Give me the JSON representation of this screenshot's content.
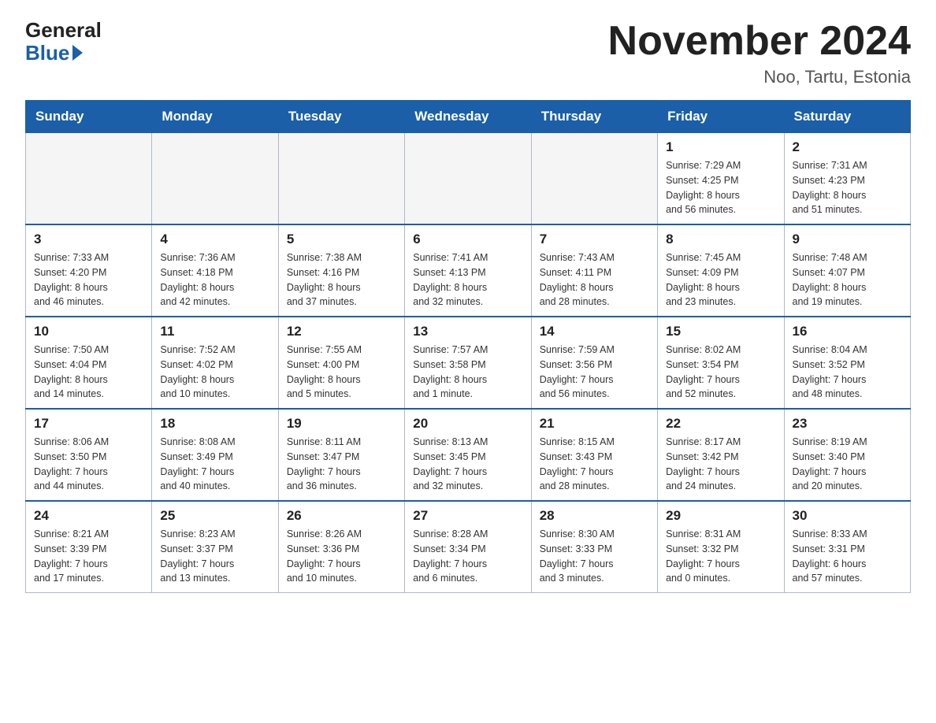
{
  "logo": {
    "general": "General",
    "blue": "Blue"
  },
  "header": {
    "month": "November 2024",
    "location": "Noo, Tartu, Estonia"
  },
  "weekdays": [
    "Sunday",
    "Monday",
    "Tuesday",
    "Wednesday",
    "Thursday",
    "Friday",
    "Saturday"
  ],
  "weeks": [
    [
      {
        "day": "",
        "info": ""
      },
      {
        "day": "",
        "info": ""
      },
      {
        "day": "",
        "info": ""
      },
      {
        "day": "",
        "info": ""
      },
      {
        "day": "",
        "info": ""
      },
      {
        "day": "1",
        "info": "Sunrise: 7:29 AM\nSunset: 4:25 PM\nDaylight: 8 hours\nand 56 minutes."
      },
      {
        "day": "2",
        "info": "Sunrise: 7:31 AM\nSunset: 4:23 PM\nDaylight: 8 hours\nand 51 minutes."
      }
    ],
    [
      {
        "day": "3",
        "info": "Sunrise: 7:33 AM\nSunset: 4:20 PM\nDaylight: 8 hours\nand 46 minutes."
      },
      {
        "day": "4",
        "info": "Sunrise: 7:36 AM\nSunset: 4:18 PM\nDaylight: 8 hours\nand 42 minutes."
      },
      {
        "day": "5",
        "info": "Sunrise: 7:38 AM\nSunset: 4:16 PM\nDaylight: 8 hours\nand 37 minutes."
      },
      {
        "day": "6",
        "info": "Sunrise: 7:41 AM\nSunset: 4:13 PM\nDaylight: 8 hours\nand 32 minutes."
      },
      {
        "day": "7",
        "info": "Sunrise: 7:43 AM\nSunset: 4:11 PM\nDaylight: 8 hours\nand 28 minutes."
      },
      {
        "day": "8",
        "info": "Sunrise: 7:45 AM\nSunset: 4:09 PM\nDaylight: 8 hours\nand 23 minutes."
      },
      {
        "day": "9",
        "info": "Sunrise: 7:48 AM\nSunset: 4:07 PM\nDaylight: 8 hours\nand 19 minutes."
      }
    ],
    [
      {
        "day": "10",
        "info": "Sunrise: 7:50 AM\nSunset: 4:04 PM\nDaylight: 8 hours\nand 14 minutes."
      },
      {
        "day": "11",
        "info": "Sunrise: 7:52 AM\nSunset: 4:02 PM\nDaylight: 8 hours\nand 10 minutes."
      },
      {
        "day": "12",
        "info": "Sunrise: 7:55 AM\nSunset: 4:00 PM\nDaylight: 8 hours\nand 5 minutes."
      },
      {
        "day": "13",
        "info": "Sunrise: 7:57 AM\nSunset: 3:58 PM\nDaylight: 8 hours\nand 1 minute."
      },
      {
        "day": "14",
        "info": "Sunrise: 7:59 AM\nSunset: 3:56 PM\nDaylight: 7 hours\nand 56 minutes."
      },
      {
        "day": "15",
        "info": "Sunrise: 8:02 AM\nSunset: 3:54 PM\nDaylight: 7 hours\nand 52 minutes."
      },
      {
        "day": "16",
        "info": "Sunrise: 8:04 AM\nSunset: 3:52 PM\nDaylight: 7 hours\nand 48 minutes."
      }
    ],
    [
      {
        "day": "17",
        "info": "Sunrise: 8:06 AM\nSunset: 3:50 PM\nDaylight: 7 hours\nand 44 minutes."
      },
      {
        "day": "18",
        "info": "Sunrise: 8:08 AM\nSunset: 3:49 PM\nDaylight: 7 hours\nand 40 minutes."
      },
      {
        "day": "19",
        "info": "Sunrise: 8:11 AM\nSunset: 3:47 PM\nDaylight: 7 hours\nand 36 minutes."
      },
      {
        "day": "20",
        "info": "Sunrise: 8:13 AM\nSunset: 3:45 PM\nDaylight: 7 hours\nand 32 minutes."
      },
      {
        "day": "21",
        "info": "Sunrise: 8:15 AM\nSunset: 3:43 PM\nDaylight: 7 hours\nand 28 minutes."
      },
      {
        "day": "22",
        "info": "Sunrise: 8:17 AM\nSunset: 3:42 PM\nDaylight: 7 hours\nand 24 minutes."
      },
      {
        "day": "23",
        "info": "Sunrise: 8:19 AM\nSunset: 3:40 PM\nDaylight: 7 hours\nand 20 minutes."
      }
    ],
    [
      {
        "day": "24",
        "info": "Sunrise: 8:21 AM\nSunset: 3:39 PM\nDaylight: 7 hours\nand 17 minutes."
      },
      {
        "day": "25",
        "info": "Sunrise: 8:23 AM\nSunset: 3:37 PM\nDaylight: 7 hours\nand 13 minutes."
      },
      {
        "day": "26",
        "info": "Sunrise: 8:26 AM\nSunset: 3:36 PM\nDaylight: 7 hours\nand 10 minutes."
      },
      {
        "day": "27",
        "info": "Sunrise: 8:28 AM\nSunset: 3:34 PM\nDaylight: 7 hours\nand 6 minutes."
      },
      {
        "day": "28",
        "info": "Sunrise: 8:30 AM\nSunset: 3:33 PM\nDaylight: 7 hours\nand 3 minutes."
      },
      {
        "day": "29",
        "info": "Sunrise: 8:31 AM\nSunset: 3:32 PM\nDaylight: 7 hours\nand 0 minutes."
      },
      {
        "day": "30",
        "info": "Sunrise: 8:33 AM\nSunset: 3:31 PM\nDaylight: 6 hours\nand 57 minutes."
      }
    ]
  ]
}
